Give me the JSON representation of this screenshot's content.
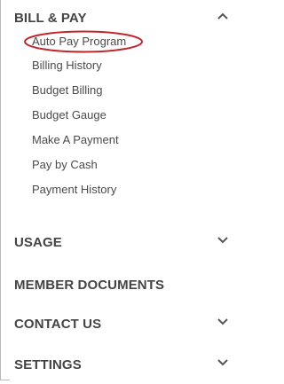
{
  "accent_color": "#c0272d",
  "menu": {
    "bill_pay": {
      "label": "BILL & PAY",
      "state": "expanded",
      "icon": "chevron-up-icon",
      "items": [
        "Auto Pay Program",
        "Billing History",
        "Budget Billing",
        "Budget Gauge",
        "Make A Payment",
        "Pay by Cash",
        "Payment History"
      ],
      "highlighted_item": "Auto Pay Program"
    },
    "usage": {
      "label": "USAGE",
      "icon": "chevron-down-icon"
    },
    "member_documents": {
      "label": "MEMBER DOCUMENTS"
    },
    "contact_us": {
      "label": "CONTACT US",
      "icon": "chevron-down-icon"
    },
    "settings": {
      "label": "SETTINGS",
      "icon": "chevron-down-icon"
    }
  }
}
